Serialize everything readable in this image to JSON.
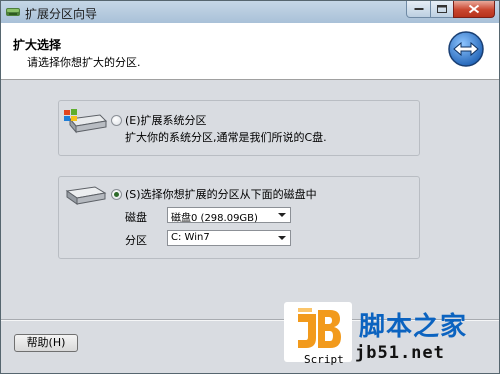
{
  "window": {
    "title": "扩展分区向导"
  },
  "header": {
    "title": "扩大选择",
    "subtitle": "请选择你想扩大的分区."
  },
  "option_system": {
    "label": "(E)扩展系统分区",
    "description": "扩大你的系统分区,通常是我们所说的C盘.",
    "checked": false
  },
  "option_other": {
    "label": "(S)选择你想扩展的分区从下面的磁盘中",
    "checked": true,
    "disk_label": "磁盘",
    "disk_value": "磁盘0 (298.09GB)",
    "partition_label": "分区",
    "partition_value": "C: Win7"
  },
  "footer": {
    "help_label": "帮助(H)"
  },
  "watermark": {
    "script_text": "Script",
    "site_name": "脚本之家",
    "site_url": "jb51.net"
  },
  "colors": {
    "client_bg": "#d9dce1",
    "watermark_blue": "#0b63c0",
    "logo_orange": "#f29a1c",
    "close_red": "#c9462f"
  },
  "icons": {
    "app": "partition-wizard-app-icon",
    "header": "wizard-back-forward-icon",
    "disk_system": "windows-disk-icon",
    "disk_other": "hard-disk-icon"
  }
}
